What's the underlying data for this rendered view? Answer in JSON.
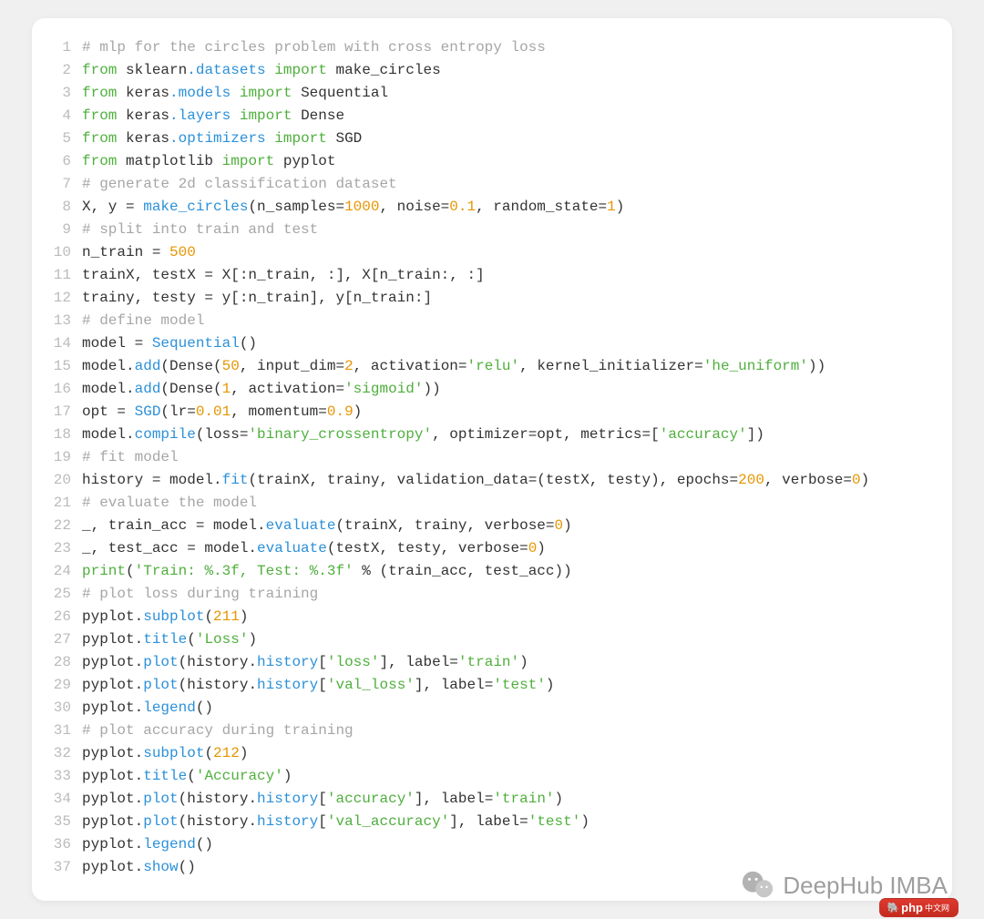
{
  "watermark": {
    "text": "DeepHub IMBA"
  },
  "badge": {
    "label": "php",
    "suffix": "中文网"
  },
  "code": [
    {
      "n": 1,
      "tokens": [
        {
          "t": "# mlp for the circles problem with cross entropy loss",
          "c": "c-comment"
        }
      ]
    },
    {
      "n": 2,
      "tokens": [
        {
          "t": "from ",
          "c": "c-kw"
        },
        {
          "t": "sklearn",
          "c": "c-mod"
        },
        {
          "t": ".datasets",
          "c": "c-sub"
        },
        {
          "t": " import ",
          "c": "c-kw"
        },
        {
          "t": "make_circles",
          "c": "c-mod"
        }
      ]
    },
    {
      "n": 3,
      "tokens": [
        {
          "t": "from ",
          "c": "c-kw"
        },
        {
          "t": "keras",
          "c": "c-mod"
        },
        {
          "t": ".models",
          "c": "c-sub"
        },
        {
          "t": " import ",
          "c": "c-kw"
        },
        {
          "t": "Sequential",
          "c": "c-mod"
        }
      ]
    },
    {
      "n": 4,
      "tokens": [
        {
          "t": "from ",
          "c": "c-kw"
        },
        {
          "t": "keras",
          "c": "c-mod"
        },
        {
          "t": ".layers",
          "c": "c-sub"
        },
        {
          "t": " import ",
          "c": "c-kw"
        },
        {
          "t": "Dense",
          "c": "c-mod"
        }
      ]
    },
    {
      "n": 5,
      "tokens": [
        {
          "t": "from ",
          "c": "c-kw"
        },
        {
          "t": "keras",
          "c": "c-mod"
        },
        {
          "t": ".optimizers",
          "c": "c-sub"
        },
        {
          "t": " import ",
          "c": "c-kw"
        },
        {
          "t": "SGD",
          "c": "c-mod"
        }
      ]
    },
    {
      "n": 6,
      "tokens": [
        {
          "t": "from ",
          "c": "c-kw"
        },
        {
          "t": "matplotlib",
          "c": "c-mod"
        },
        {
          "t": " import ",
          "c": "c-kw"
        },
        {
          "t": "pyplot",
          "c": "c-mod"
        }
      ]
    },
    {
      "n": 7,
      "tokens": [
        {
          "t": "# generate 2d classification dataset",
          "c": "c-comment"
        }
      ]
    },
    {
      "n": 8,
      "tokens": [
        {
          "t": "X, y = ",
          "c": "c-mod"
        },
        {
          "t": "make_circles",
          "c": "c-func"
        },
        {
          "t": "(n_samples=",
          "c": "c-mod"
        },
        {
          "t": "1000",
          "c": "c-num"
        },
        {
          "t": ", noise=",
          "c": "c-mod"
        },
        {
          "t": "0.1",
          "c": "c-num"
        },
        {
          "t": ", random_state=",
          "c": "c-mod"
        },
        {
          "t": "1",
          "c": "c-num"
        },
        {
          "t": ")",
          "c": "c-mod"
        }
      ]
    },
    {
      "n": 9,
      "tokens": [
        {
          "t": "# split into train and test",
          "c": "c-comment"
        }
      ]
    },
    {
      "n": 10,
      "tokens": [
        {
          "t": "n_train = ",
          "c": "c-mod"
        },
        {
          "t": "500",
          "c": "c-num"
        }
      ]
    },
    {
      "n": 11,
      "tokens": [
        {
          "t": "trainX, testX = X[:n_train, :], X[n_train:, :]",
          "c": "c-mod"
        }
      ]
    },
    {
      "n": 12,
      "tokens": [
        {
          "t": "trainy, testy = y[:n_train], y[n_train:]",
          "c": "c-mod"
        }
      ]
    },
    {
      "n": 13,
      "tokens": [
        {
          "t": "# define model",
          "c": "c-comment"
        }
      ]
    },
    {
      "n": 14,
      "tokens": [
        {
          "t": "model = ",
          "c": "c-mod"
        },
        {
          "t": "Sequential",
          "c": "c-func"
        },
        {
          "t": "()",
          "c": "c-mod"
        }
      ]
    },
    {
      "n": 15,
      "tokens": [
        {
          "t": "model.",
          "c": "c-mod"
        },
        {
          "t": "add",
          "c": "c-func"
        },
        {
          "t": "(Dense(",
          "c": "c-mod"
        },
        {
          "t": "50",
          "c": "c-num"
        },
        {
          "t": ", input_dim=",
          "c": "c-mod"
        },
        {
          "t": "2",
          "c": "c-num"
        },
        {
          "t": ", activation=",
          "c": "c-mod"
        },
        {
          "t": "'relu'",
          "c": "c-str"
        },
        {
          "t": ", kernel_initializer=",
          "c": "c-mod"
        },
        {
          "t": "'he_uniform'",
          "c": "c-str"
        },
        {
          "t": "))",
          "c": "c-mod"
        }
      ]
    },
    {
      "n": 16,
      "tokens": [
        {
          "t": "model.",
          "c": "c-mod"
        },
        {
          "t": "add",
          "c": "c-func"
        },
        {
          "t": "(Dense(",
          "c": "c-mod"
        },
        {
          "t": "1",
          "c": "c-num"
        },
        {
          "t": ", activation=",
          "c": "c-mod"
        },
        {
          "t": "'sigmoid'",
          "c": "c-str"
        },
        {
          "t": "))",
          "c": "c-mod"
        }
      ]
    },
    {
      "n": 17,
      "tokens": [
        {
          "t": "opt = ",
          "c": "c-mod"
        },
        {
          "t": "SGD",
          "c": "c-func"
        },
        {
          "t": "(lr=",
          "c": "c-mod"
        },
        {
          "t": "0.01",
          "c": "c-num"
        },
        {
          "t": ", momentum=",
          "c": "c-mod"
        },
        {
          "t": "0.9",
          "c": "c-num"
        },
        {
          "t": ")",
          "c": "c-mod"
        }
      ]
    },
    {
      "n": 18,
      "tokens": [
        {
          "t": "model.",
          "c": "c-mod"
        },
        {
          "t": "compile",
          "c": "c-func"
        },
        {
          "t": "(loss=",
          "c": "c-mod"
        },
        {
          "t": "'binary_crossentropy'",
          "c": "c-str"
        },
        {
          "t": ", optimizer=opt, metrics=[",
          "c": "c-mod"
        },
        {
          "t": "'accuracy'",
          "c": "c-str"
        },
        {
          "t": "])",
          "c": "c-mod"
        }
      ]
    },
    {
      "n": 19,
      "tokens": [
        {
          "t": "# fit model",
          "c": "c-comment"
        }
      ]
    },
    {
      "n": 20,
      "tokens": [
        {
          "t": "history = model.",
          "c": "c-mod"
        },
        {
          "t": "fit",
          "c": "c-func"
        },
        {
          "t": "(trainX, trainy, validation_data=(testX, testy), epochs=",
          "c": "c-mod"
        },
        {
          "t": "200",
          "c": "c-num"
        },
        {
          "t": ", verbose=",
          "c": "c-mod"
        },
        {
          "t": "0",
          "c": "c-num"
        },
        {
          "t": ")",
          "c": "c-mod"
        }
      ]
    },
    {
      "n": 21,
      "tokens": [
        {
          "t": "# evaluate the model",
          "c": "c-comment"
        }
      ]
    },
    {
      "n": 22,
      "tokens": [
        {
          "t": "_, train_acc = model.",
          "c": "c-mod"
        },
        {
          "t": "evaluate",
          "c": "c-func"
        },
        {
          "t": "(trainX, trainy, verbose=",
          "c": "c-mod"
        },
        {
          "t": "0",
          "c": "c-num"
        },
        {
          "t": ")",
          "c": "c-mod"
        }
      ]
    },
    {
      "n": 23,
      "tokens": [
        {
          "t": "_, test_acc = model.",
          "c": "c-mod"
        },
        {
          "t": "evaluate",
          "c": "c-func"
        },
        {
          "t": "(testX, testy, verbose=",
          "c": "c-mod"
        },
        {
          "t": "0",
          "c": "c-num"
        },
        {
          "t": ")",
          "c": "c-mod"
        }
      ]
    },
    {
      "n": 24,
      "tokens": [
        {
          "t": "print",
          "c": "c-built"
        },
        {
          "t": "(",
          "c": "c-mod"
        },
        {
          "t": "'Train: %.3f, Test: %.3f'",
          "c": "c-str"
        },
        {
          "t": " % (train_acc, test_acc))",
          "c": "c-mod"
        }
      ]
    },
    {
      "n": 25,
      "tokens": [
        {
          "t": "# plot loss during training",
          "c": "c-comment"
        }
      ]
    },
    {
      "n": 26,
      "tokens": [
        {
          "t": "pyplot.",
          "c": "c-mod"
        },
        {
          "t": "subplot",
          "c": "c-func"
        },
        {
          "t": "(",
          "c": "c-mod"
        },
        {
          "t": "211",
          "c": "c-num"
        },
        {
          "t": ")",
          "c": "c-mod"
        }
      ]
    },
    {
      "n": 27,
      "tokens": [
        {
          "t": "pyplot.",
          "c": "c-mod"
        },
        {
          "t": "title",
          "c": "c-func"
        },
        {
          "t": "(",
          "c": "c-mod"
        },
        {
          "t": "'Loss'",
          "c": "c-str"
        },
        {
          "t": ")",
          "c": "c-mod"
        }
      ]
    },
    {
      "n": 28,
      "tokens": [
        {
          "t": "pyplot.",
          "c": "c-mod"
        },
        {
          "t": "plot",
          "c": "c-func"
        },
        {
          "t": "(history.",
          "c": "c-mod"
        },
        {
          "t": "history",
          "c": "c-func"
        },
        {
          "t": "[",
          "c": "c-mod"
        },
        {
          "t": "'loss'",
          "c": "c-str"
        },
        {
          "t": "], label=",
          "c": "c-mod"
        },
        {
          "t": "'train'",
          "c": "c-str"
        },
        {
          "t": ")",
          "c": "c-mod"
        }
      ]
    },
    {
      "n": 29,
      "tokens": [
        {
          "t": "pyplot.",
          "c": "c-mod"
        },
        {
          "t": "plot",
          "c": "c-func"
        },
        {
          "t": "(history.",
          "c": "c-mod"
        },
        {
          "t": "history",
          "c": "c-func"
        },
        {
          "t": "[",
          "c": "c-mod"
        },
        {
          "t": "'val_loss'",
          "c": "c-str"
        },
        {
          "t": "], label=",
          "c": "c-mod"
        },
        {
          "t": "'test'",
          "c": "c-str"
        },
        {
          "t": ")",
          "c": "c-mod"
        }
      ]
    },
    {
      "n": 30,
      "tokens": [
        {
          "t": "pyplot.",
          "c": "c-mod"
        },
        {
          "t": "legend",
          "c": "c-func"
        },
        {
          "t": "()",
          "c": "c-mod"
        }
      ]
    },
    {
      "n": 31,
      "tokens": [
        {
          "t": "# plot accuracy during training",
          "c": "c-comment"
        }
      ]
    },
    {
      "n": 32,
      "tokens": [
        {
          "t": "pyplot.",
          "c": "c-mod"
        },
        {
          "t": "subplot",
          "c": "c-func"
        },
        {
          "t": "(",
          "c": "c-mod"
        },
        {
          "t": "212",
          "c": "c-num"
        },
        {
          "t": ")",
          "c": "c-mod"
        }
      ]
    },
    {
      "n": 33,
      "tokens": [
        {
          "t": "pyplot.",
          "c": "c-mod"
        },
        {
          "t": "title",
          "c": "c-func"
        },
        {
          "t": "(",
          "c": "c-mod"
        },
        {
          "t": "'Accuracy'",
          "c": "c-str"
        },
        {
          "t": ")",
          "c": "c-mod"
        }
      ]
    },
    {
      "n": 34,
      "tokens": [
        {
          "t": "pyplot.",
          "c": "c-mod"
        },
        {
          "t": "plot",
          "c": "c-func"
        },
        {
          "t": "(history.",
          "c": "c-mod"
        },
        {
          "t": "history",
          "c": "c-func"
        },
        {
          "t": "[",
          "c": "c-mod"
        },
        {
          "t": "'accuracy'",
          "c": "c-str"
        },
        {
          "t": "], label=",
          "c": "c-mod"
        },
        {
          "t": "'train'",
          "c": "c-str"
        },
        {
          "t": ")",
          "c": "c-mod"
        }
      ]
    },
    {
      "n": 35,
      "tokens": [
        {
          "t": "pyplot.",
          "c": "c-mod"
        },
        {
          "t": "plot",
          "c": "c-func"
        },
        {
          "t": "(history.",
          "c": "c-mod"
        },
        {
          "t": "history",
          "c": "c-func"
        },
        {
          "t": "[",
          "c": "c-mod"
        },
        {
          "t": "'val_accuracy'",
          "c": "c-str"
        },
        {
          "t": "], label=",
          "c": "c-mod"
        },
        {
          "t": "'test'",
          "c": "c-str"
        },
        {
          "t": ")",
          "c": "c-mod"
        }
      ]
    },
    {
      "n": 36,
      "tokens": [
        {
          "t": "pyplot.",
          "c": "c-mod"
        },
        {
          "t": "legend",
          "c": "c-func"
        },
        {
          "t": "()",
          "c": "c-mod"
        }
      ]
    },
    {
      "n": 37,
      "tokens": [
        {
          "t": "pyplot.",
          "c": "c-mod"
        },
        {
          "t": "show",
          "c": "c-func"
        },
        {
          "t": "()",
          "c": "c-mod"
        }
      ]
    }
  ]
}
